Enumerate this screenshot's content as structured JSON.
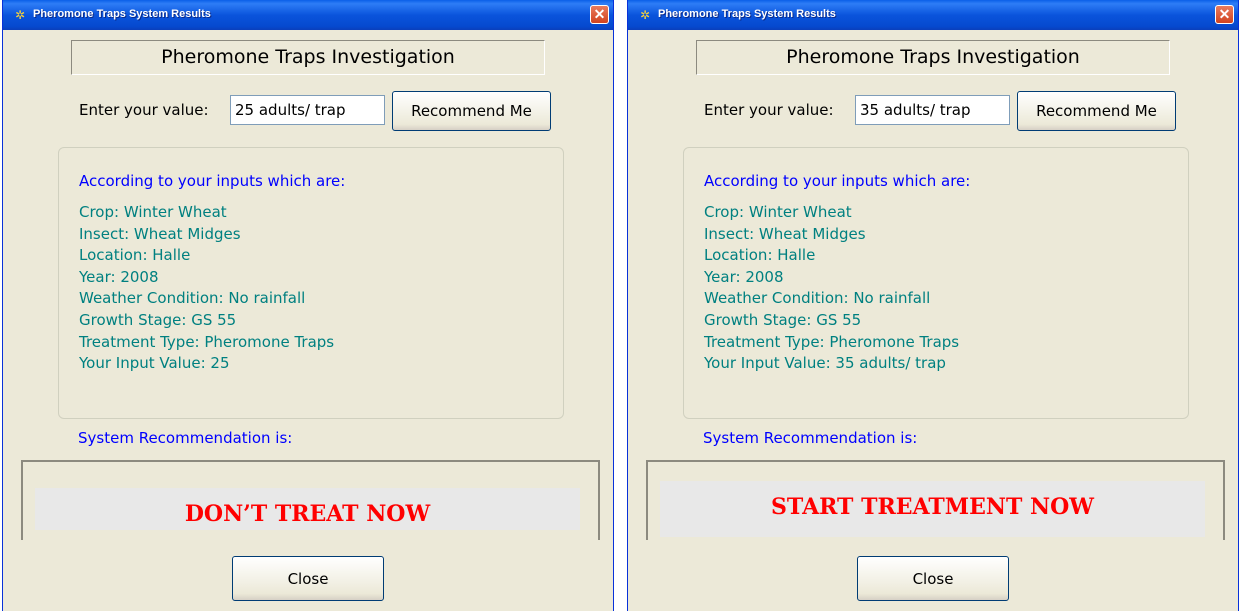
{
  "windows": [
    {
      "title": "Pheromone Traps System Results",
      "close_glyph": "✕",
      "heading": "Pheromone Traps Investigation",
      "enter_label": "Enter your value:",
      "input_value": "25 adults/ trap",
      "recommend_button": "Recommend Me",
      "according_label": "According to your inputs which are:",
      "info_lines": [
        "Crop: Winter Wheat",
        "Insect: Wheat Midges",
        "Location: Halle",
        "Year: 2008",
        "Weather Condition: No rainfall",
        "Growth Stage: GS 55",
        "Treatment Type: Pheromone Traps",
        "Your Input Value: 25"
      ],
      "recommendation_label": "System Recommendation is:",
      "recommendation": "DON’T TREAT NOW",
      "close_button": "Close"
    },
    {
      "title": "Pheromone Traps System Results",
      "close_glyph": "✕",
      "heading": "Pheromone Traps Investigation",
      "enter_label": "Enter your value:",
      "input_value": "35 adults/ trap",
      "recommend_button": "Recommend Me",
      "according_label": "According to your inputs which are:",
      "info_lines": [
        "Crop: Winter Wheat",
        "Insect: Wheat Midges",
        "Location: Halle",
        "Year: 2008",
        "Weather Condition: No rainfall",
        "Growth Stage: GS 55",
        "Treatment Type: Pheromone Traps",
        "Your Input Value: 35 adults/ trap"
      ],
      "recommendation_label": "System Recommendation is:",
      "recommendation": "START TREATMENT NOW",
      "close_button": "Close"
    }
  ],
  "icons": {
    "app": "app-icon",
    "close": "close-icon"
  },
  "colors": {
    "title_bar": "#0a54dc",
    "window_bg": "#ece9d8",
    "label_blue": "#0000ff",
    "info_teal": "#008080",
    "recommendation_red": "#ff0000"
  }
}
